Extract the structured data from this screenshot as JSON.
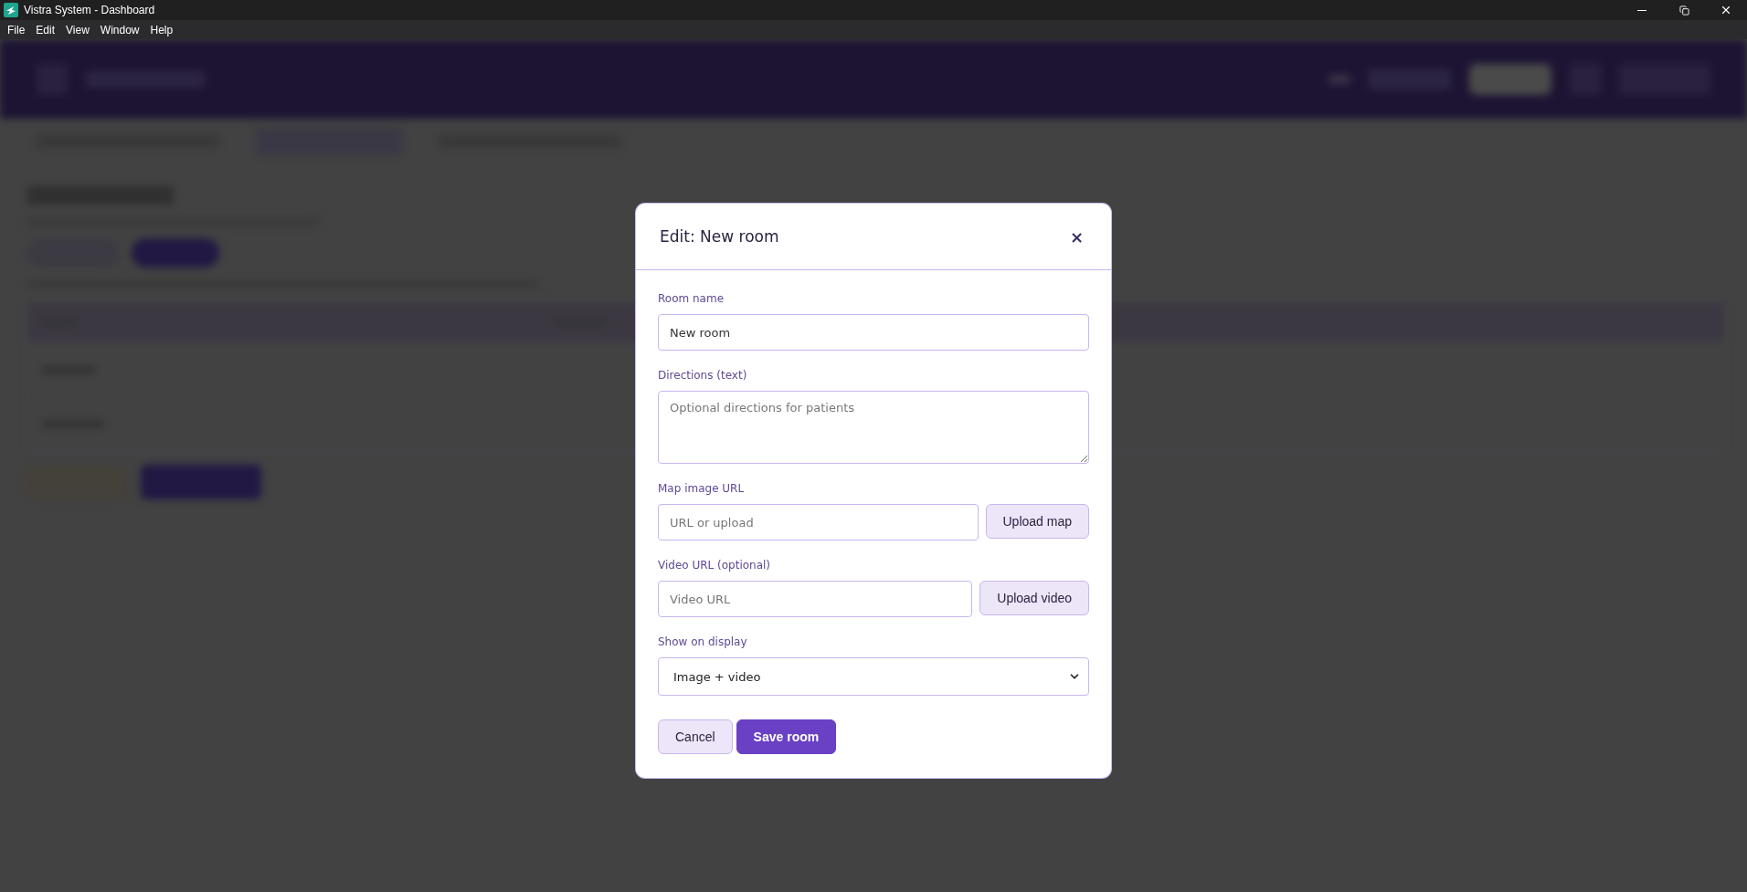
{
  "window": {
    "title": "Vistra System - Dashboard"
  },
  "menu_bar": [
    "File",
    "Edit",
    "View",
    "Window",
    "Help"
  ],
  "dialog": {
    "title": "Edit: New room",
    "close": "×",
    "fields": [
      {
        "kind": "input",
        "label": "Room name",
        "value": "New room"
      },
      {
        "kind": "textarea",
        "label": "Directions (text)",
        "placeholder": "Optional directions for patients"
      },
      {
        "kind": "upload",
        "label": "Map image URL",
        "placeholder": "URL or upload",
        "button": "Upload map"
      },
      {
        "kind": "upload",
        "label": "Video URL (optional)",
        "placeholder": "Video URL",
        "button": "Upload video"
      },
      {
        "kind": "select",
        "label": "Show on display",
        "value": "Image + video"
      }
    ],
    "buttons": [
      {
        "label": "Cancel",
        "kind": "secondary"
      },
      {
        "label": "Save room",
        "kind": "primary"
      }
    ]
  }
}
